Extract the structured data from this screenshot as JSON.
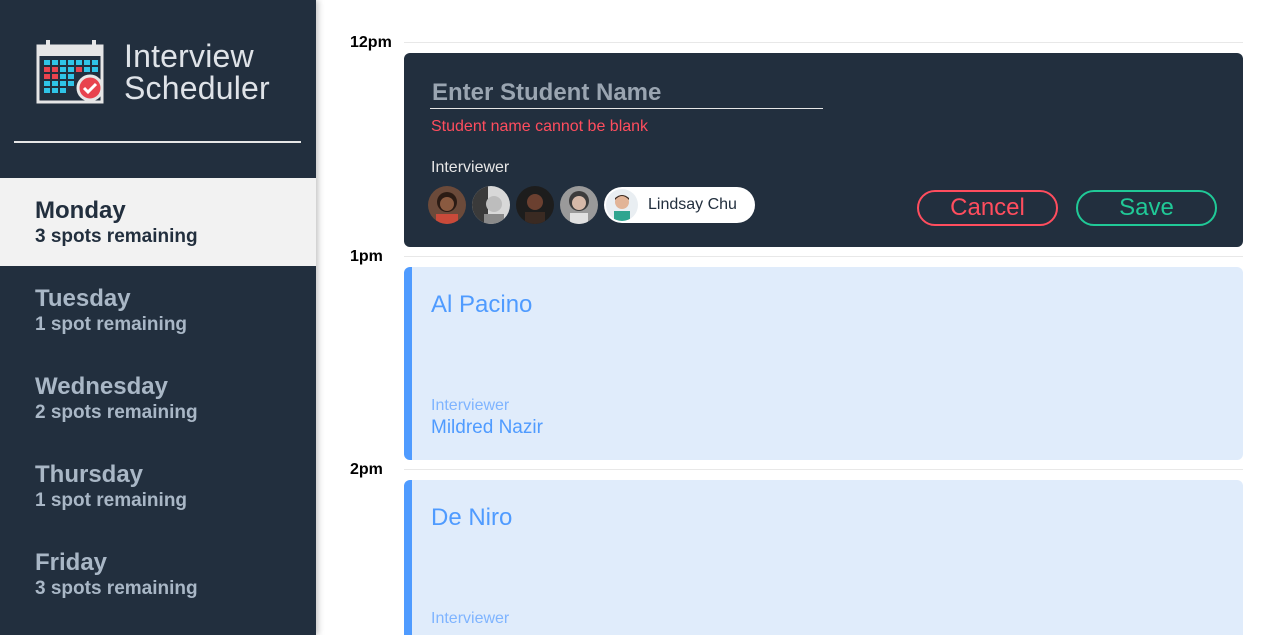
{
  "app": {
    "title_line1": "Interview",
    "title_line2": "Scheduler",
    "logo_icon": "calendar-check-icon"
  },
  "days": [
    {
      "name": "Monday",
      "spots": "3 spots remaining",
      "selected": true
    },
    {
      "name": "Tuesday",
      "spots": "1 spot remaining",
      "selected": false
    },
    {
      "name": "Wednesday",
      "spots": "2 spots remaining",
      "selected": false
    },
    {
      "name": "Thursday",
      "spots": "1 spot remaining",
      "selected": false
    },
    {
      "name": "Friday",
      "spots": "3 spots remaining",
      "selected": false
    }
  ],
  "slots": [
    {
      "time": "12pm"
    },
    {
      "time": "1pm"
    },
    {
      "time": "2pm"
    }
  ],
  "form": {
    "name_placeholder": "Enter Student Name",
    "name_value": "",
    "error": "Student name cannot be blank",
    "interviewer_label": "Interviewer",
    "selected_interviewer": "Lindsay Chu",
    "cancel_label": "Cancel",
    "save_label": "Save"
  },
  "appointments": [
    {
      "student": "Al Pacino",
      "interviewer_label": "Interviewer",
      "interviewer": "Mildred Nazir"
    },
    {
      "student": "De Niro",
      "interviewer_label": "Interviewer",
      "interviewer": ""
    }
  ],
  "colors": {
    "sidebar_bg": "#222f3e",
    "selected_day_bg": "#f2f2f2",
    "error": "#ff4d5e",
    "save": "#20c997",
    "appointment_accent": "#4f9bff",
    "appointment_bg": "#e0ecfb"
  }
}
